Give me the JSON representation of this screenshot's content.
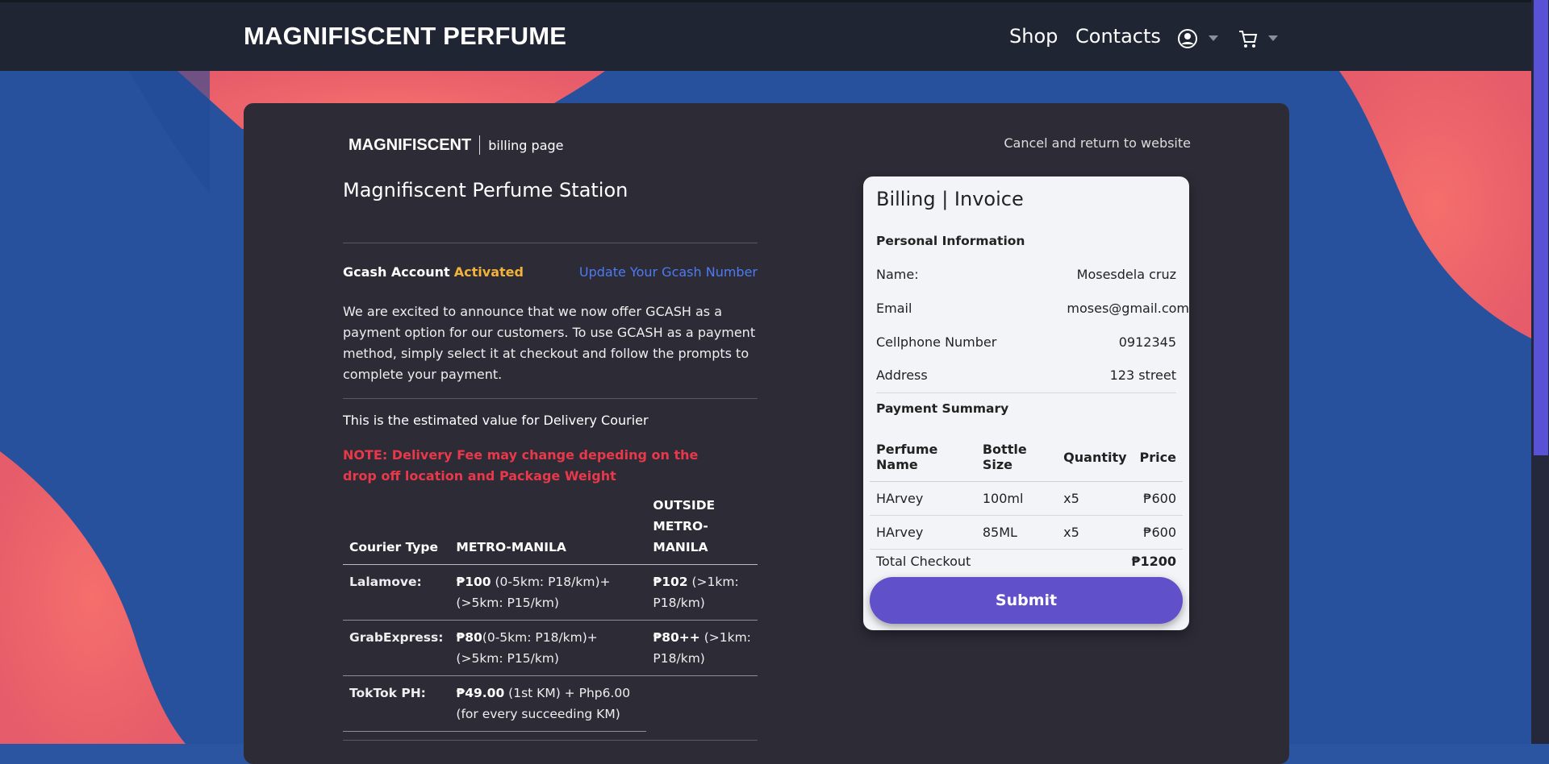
{
  "navbar": {
    "brand": "MAGNIFISCENT PERFUME",
    "links": {
      "shop": "Shop",
      "contacts": "Contacts"
    },
    "icons": [
      "user-circle-icon",
      "cart-icon"
    ]
  },
  "billing": {
    "logo_main": "MAGNIFISCENT",
    "logo_sub": "billing page",
    "cancel_link": "Cancel and return to website",
    "station_title": "Magnifiscent Perfume Station",
    "gcash": {
      "label": "Gcash Account",
      "status": "Activated",
      "update_link": "Update Your Gcash Number"
    },
    "announcement": "We are excited to announce that we now offer GCASH as a payment option for our customers. To use GCASH as a payment method, simply select it at checkout and follow the prompts to complete your payment.",
    "estimate_text": "This is the estimated value for Delivery Courier",
    "note": "NOTE: Delivery Fee may change depeding on the drop off location and Package Weight",
    "courier_table": {
      "headers": [
        "Courier Type",
        "METRO-MANILA",
        "OUTSIDE METRO-MANILA"
      ],
      "rows": [
        {
          "name": "Lalamove:",
          "metro_bold": "₱100",
          "metro_rest": " (0-5km: P18/km)+ (>5km: P15/km)",
          "outside_bold": "₱102",
          "outside_rest": " (>1km: P18/km)"
        },
        {
          "name": "GrabExpress:",
          "metro_bold": "₱80",
          "metro_rest": "(0-5km: P18/km)+(>5km: P15/km)",
          "outside_bold": "₱80++",
          "outside_rest": " (>1km: P18/km)"
        },
        {
          "name": "TokTok PH:",
          "metro_bold": "₱49.00",
          "metro_rest": " (1st KM) + Php6.00 (for every succeeding KM)",
          "outside_bold": "",
          "outside_rest": ""
        }
      ]
    }
  },
  "invoice": {
    "title": "Billing | Invoice",
    "personal_heading": "Personal Information",
    "fields": {
      "name_label": "Name:",
      "name_value": "Mosesdela cruz",
      "email_label": "Email",
      "email_value": "moses@gmail.com",
      "phone_label": "Cellphone Number",
      "phone_value": "0912345",
      "address_label": "Address",
      "address_value": "123 street"
    },
    "payment_heading": "Payment Summary",
    "payment_table": {
      "headers": [
        "Perfume Name",
        "Bottle Size",
        "Quantity",
        "Price"
      ],
      "rows": [
        [
          "HArvey",
          "100ml",
          "x5",
          "₱600"
        ],
        [
          "HArvey",
          "85ML",
          "x5",
          "₱600"
        ]
      ]
    },
    "total_label": "Total Checkout",
    "total_value": "₱1200",
    "submit_label": "Submit"
  },
  "colors": {
    "navbar": "#1f2532",
    "panel": "#2d2b36",
    "accent": "#6050c9",
    "activated": "#f2b33a",
    "link": "#4d7bf3",
    "note": "#e8384a",
    "bg_blue": "#2b55a0",
    "bg_coral": "#f2676a"
  }
}
